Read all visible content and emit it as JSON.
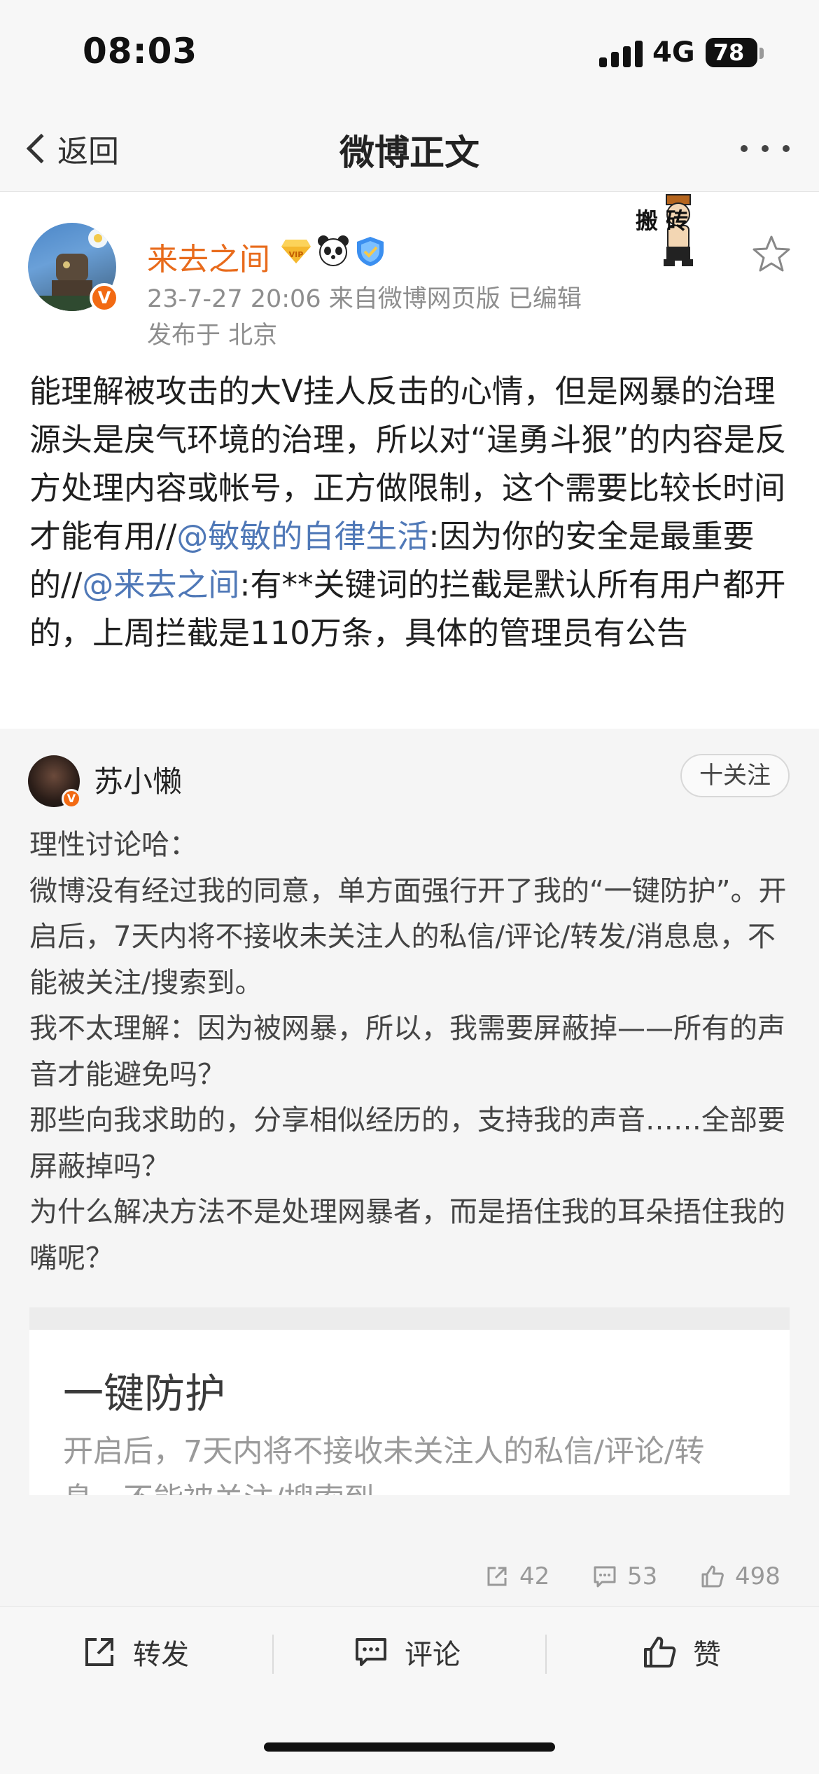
{
  "status_bar": {
    "time": "08:03",
    "network": "4G",
    "battery": "78"
  },
  "nav": {
    "back_label": "返回",
    "title": "微博正文",
    "more_icon": "more-icon"
  },
  "post": {
    "author": "来去之间",
    "meta": "23-7-27 20:06  来自微博网页版  已编辑",
    "location": "发布于 北京",
    "badge_text": "V",
    "decoration_text": "搬 砖",
    "text_part1": "能理解被攻击的大Ⅴ挂人反击的心情，但是网暴的治理源头是戾气环境的治理，所以对“逞勇斗狠”的内容是反方处理内容或帐号，正方做限制，这个需要比较长时间才能有用//",
    "mention1": "@敏敏的自律生活",
    "text_part2": ":因为你的安全是最重要的//",
    "mention2": "@来去之间",
    "text_part3": ":有**关键词的拦截是默认所有用户都开的，上周拦截是110万条，具体的管理员有公告"
  },
  "retweet": {
    "author": "苏小懒",
    "follow_label": "十关注",
    "text": "理性讨论哈：\n微博没有经过我的同意，单方面强行开了我的“一键防护”。开启后，7天内将不接收未关注人的私信/评论/转发/消息息，不能被关注/搜索到。\n我不太理解：因为被网暴，所以，我需要屏蔽掉——所有的声音才能避免吗？\n那些向我求助的，分享相似经历的，支持我的声音……全部要屏蔽掉吗？\n为什么解决方法不是处理网暴者，而是捂住我的耳朵捂住我的嘴呢？",
    "card": {
      "title": "一键防护",
      "desc_line1": "开启后，7天内将不接收未关注人的私信/评论/转",
      "desc_line2": "息，不能被关注/搜索到"
    },
    "stats": {
      "reposts": "42",
      "comments": "53",
      "likes": "498"
    }
  },
  "toolbar": {
    "repost_label": "转发",
    "comment_label": "评论",
    "like_label": "赞"
  },
  "colors": {
    "author_orange": "#e86b1c",
    "mention_blue": "#4f78b7",
    "badge_orange": "#f26a13"
  }
}
